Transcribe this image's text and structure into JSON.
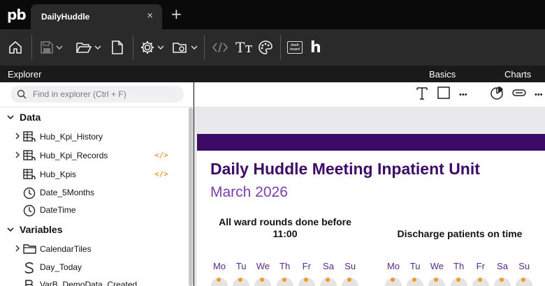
{
  "app": {
    "logo": "pb"
  },
  "tabs": [
    {
      "label": "DailyHuddle",
      "close": "×"
    }
  ],
  "new_tab": "+",
  "toolbar": {
    "icons": [
      "home-icon",
      "save-icon",
      "open-folder-icon",
      "new-file-icon",
      "settings-icon",
      "folder-settings-icon",
      "code-icon",
      "text-format-icon",
      "theme-icon",
      "dashboard-icon",
      "h-logo-icon"
    ],
    "dashboard_icon_text": "dash board",
    "h_logo": "h"
  },
  "headers": {
    "explorer": "Explorer",
    "basics": "Basics",
    "charts": "Charts"
  },
  "search": {
    "placeholder": "Find in explorer (Ctrl + F)"
  },
  "explorer": {
    "sections": [
      {
        "label": "Data",
        "items": [
          {
            "label": "Hub_Kpi_History",
            "icon": "table-icon",
            "expandable": true,
            "code": ""
          },
          {
            "label": "Hub_Kpi_Records",
            "icon": "table-icon",
            "expandable": true,
            "code": "</>"
          },
          {
            "label": "Hub_Kpis",
            "icon": "table-icon",
            "expandable": false,
            "code": "</>"
          },
          {
            "label": "Date_5Months",
            "icon": "clock-icon",
            "expandable": false,
            "code": ""
          },
          {
            "label": "DateTime",
            "icon": "clock-icon",
            "expandable": false,
            "code": ""
          }
        ]
      },
      {
        "label": "Variables",
        "items": [
          {
            "label": "CalendarTiles",
            "icon": "folder-icon",
            "expandable": true
          },
          {
            "label": "Day_Today",
            "icon": "string-icon",
            "expandable": false
          },
          {
            "label": "VarB_DemoData_Created",
            "icon": "boolean-icon",
            "expandable": false
          }
        ]
      }
    ]
  },
  "canvas_toolbar": {
    "basics_icons": [
      "text-icon",
      "rectangle-icon",
      "more-icon"
    ],
    "charts_icons": [
      "pie-chart-icon",
      "toggle-icon",
      "more-icon"
    ],
    "more": "•••"
  },
  "report": {
    "title": "Daily Huddle Meeting Inpatient Unit",
    "subtitle": "March 2026",
    "kpis": [
      {
        "title_line1": "All ward rounds done before",
        "title_line2": "11:00"
      },
      {
        "title_line1": "Discharge patients on time",
        "title_line2": ""
      }
    ],
    "weekdays": [
      "Mo",
      "Tu",
      "We",
      "Th",
      "Fr",
      "Sa",
      "Su"
    ],
    "colors": {
      "header_bar": "#3d0a68",
      "title": "#3d0a68",
      "subtitle": "#7b3fb0",
      "dot": "#f29c1f"
    }
  }
}
